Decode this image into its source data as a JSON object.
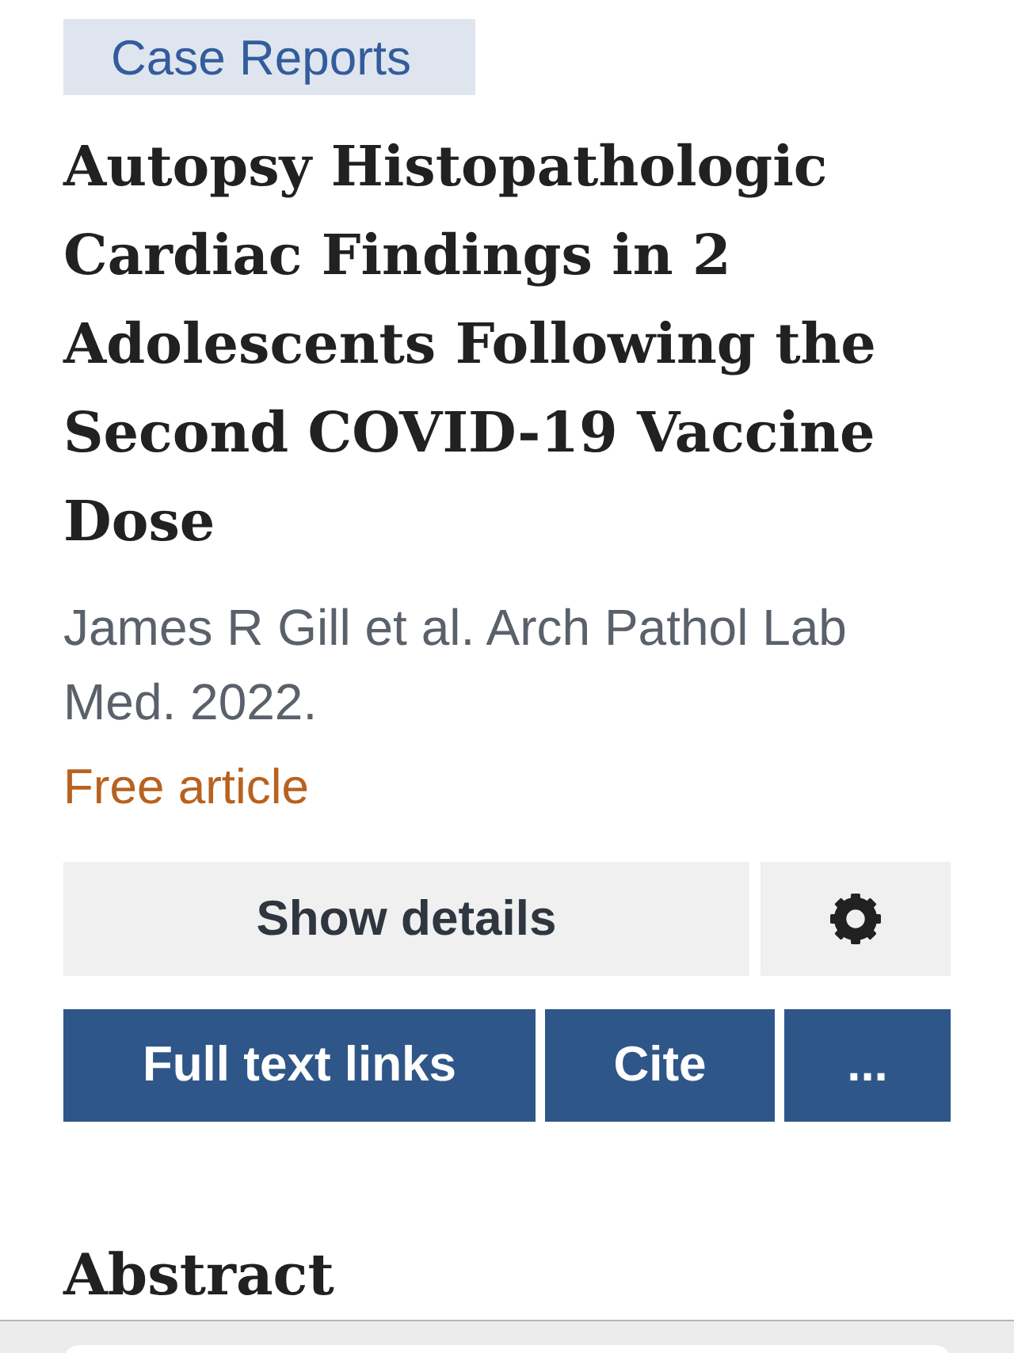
{
  "publication_type": "Case Reports",
  "title": "Autopsy Histopathologic Cardiac Findings in 2 Adolescents Following the Second COVID-19 Vaccine Dose",
  "citation": "James R Gill et al. Arch Pathol Lab Med. 2022.",
  "access_label": "Free article",
  "details_button": {
    "label": "Show details"
  },
  "action_buttons": [
    {
      "label": "Full text links"
    },
    {
      "label": "Cite"
    },
    {
      "label": "..."
    }
  ],
  "section_heading": "Abstract"
}
